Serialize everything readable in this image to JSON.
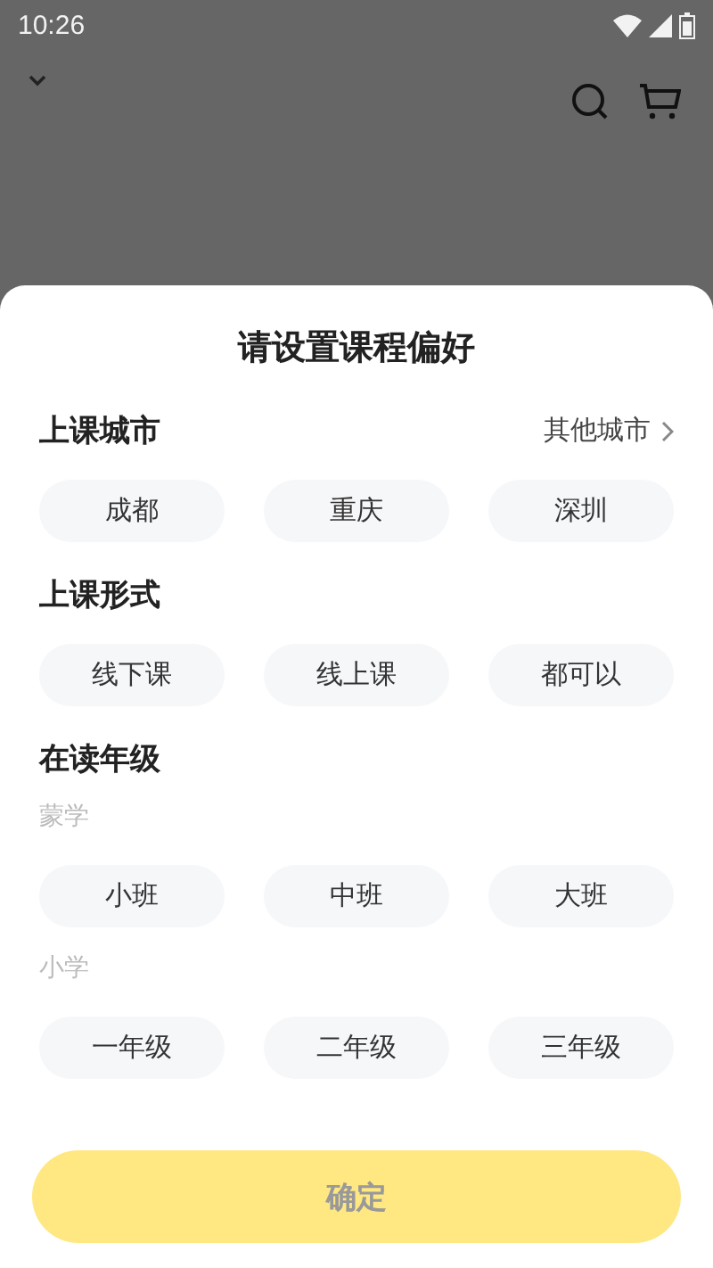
{
  "status_bar": {
    "time": "10:26"
  },
  "sheet": {
    "title": "请设置课程偏好",
    "sections": [
      {
        "title": "上课城市",
        "link": "其他城市",
        "groups": [
          {
            "options": [
              {
                "label": "成都",
                "selected": false
              },
              {
                "label": "重庆",
                "selected": false
              },
              {
                "label": "深圳",
                "selected": false
              }
            ]
          }
        ]
      },
      {
        "title": "上课形式",
        "groups": [
          {
            "options": [
              {
                "label": "线下课",
                "selected": false
              },
              {
                "label": "线上课",
                "selected": false
              },
              {
                "label": "都可以",
                "selected": false
              }
            ]
          }
        ]
      },
      {
        "title": "在读年级",
        "groups": [
          {
            "label": "蒙学",
            "options": [
              {
                "label": "小班",
                "selected": false
              },
              {
                "label": "中班",
                "selected": false
              },
              {
                "label": "大班",
                "selected": false
              }
            ]
          },
          {
            "label": "小学",
            "options": [
              {
                "label": "一年级",
                "selected": false
              },
              {
                "label": "二年级",
                "selected": false
              },
              {
                "label": "三年级",
                "selected": false
              }
            ]
          }
        ]
      }
    ],
    "confirm": {
      "label": "确定",
      "disabled": true
    }
  }
}
